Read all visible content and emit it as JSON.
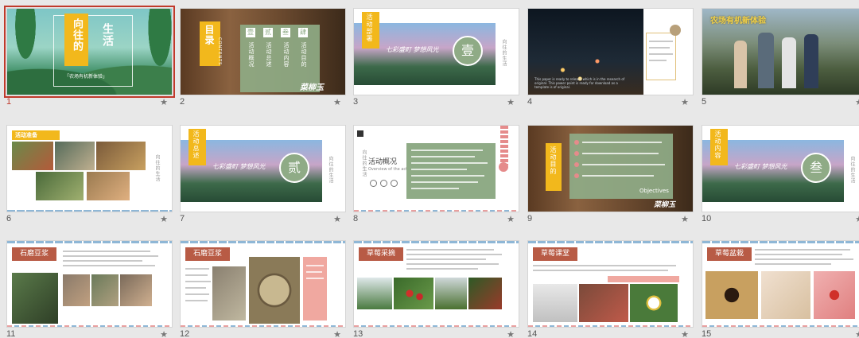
{
  "slides": [
    {
      "num": "1",
      "title_a": "向往的",
      "title_b": "生活",
      "subtitle": "「农场有机新体验」"
    },
    {
      "num": "2",
      "toc_title": "目录",
      "toc_en": "CONTENTS",
      "items": [
        "活动概况",
        "活动总述",
        "活动内容",
        "活动目的"
      ],
      "badges": [
        "壹",
        "贰",
        "叁",
        "肆"
      ],
      "brand": "菜柳玉"
    },
    {
      "num": "3",
      "tag": "活动部署",
      "badge": "壹",
      "brush": "七彩盛町 梦想风光",
      "side": "向往的生活"
    },
    {
      "num": "4",
      "body": "This paper is ready to release which is in the research of original. This power point is ready for download as a template is of original."
    },
    {
      "num": "5",
      "banner": "农场有机新体验"
    },
    {
      "num": "6",
      "tag": "活动准备",
      "side": "向往的生活"
    },
    {
      "num": "7",
      "tag": "活动总述",
      "badge": "贰",
      "brush": "七彩盛町 梦想风光",
      "side": "向往的生活"
    },
    {
      "num": "8",
      "side": "向往的生活",
      "title": "活动概况",
      "subtitle": "Overview of the activity"
    },
    {
      "num": "9",
      "tag": "活动目的",
      "footer": "Objectives",
      "brand": "菜柳玉"
    },
    {
      "num": "10",
      "tag": "活动内容",
      "badge": "叁",
      "brush": "七彩盛町 梦想风光",
      "side": "向往的生活"
    },
    {
      "num": "11",
      "label": "石磨豆浆"
    },
    {
      "num": "12",
      "label": "石磨豆浆"
    },
    {
      "num": "13",
      "label": "草莓采摘"
    },
    {
      "num": "14",
      "label": "草莓课堂"
    },
    {
      "num": "15",
      "label": "草莓盆栽"
    }
  ],
  "star_glyph": "★"
}
